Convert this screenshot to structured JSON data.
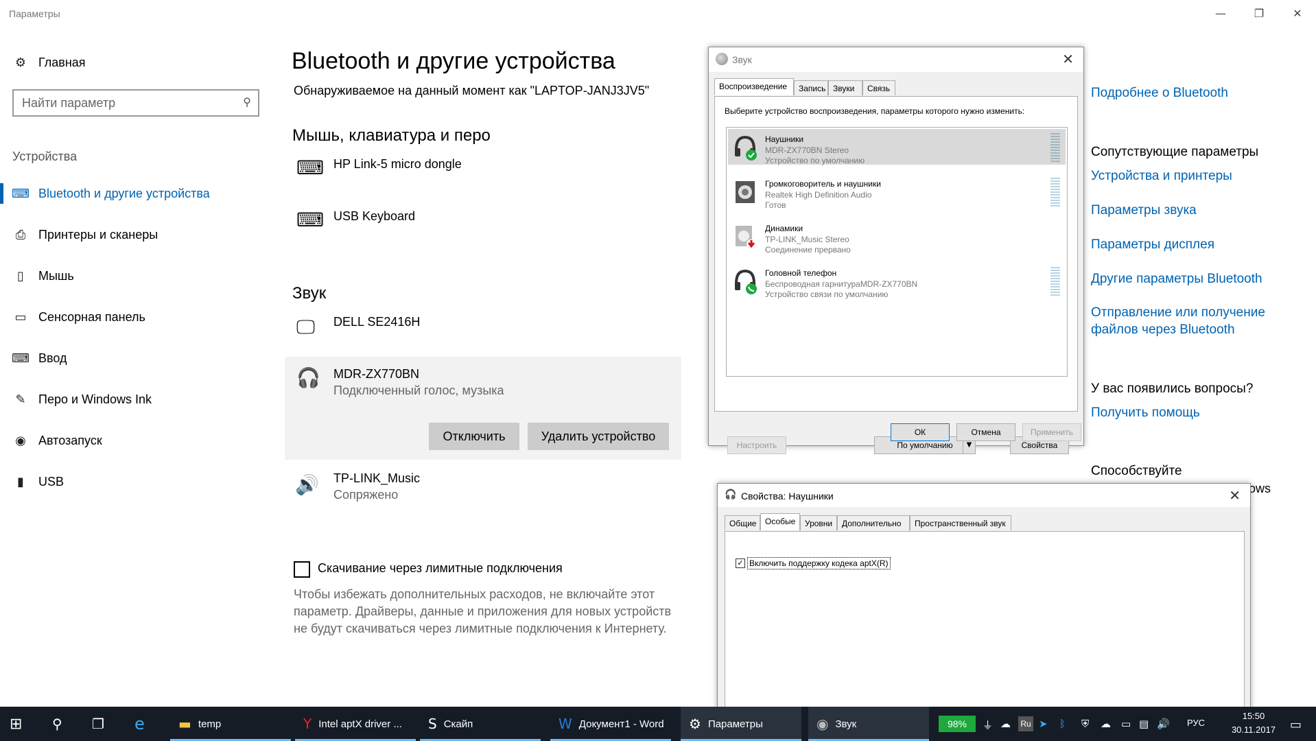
{
  "window": {
    "title": "Параметры",
    "minimize": "—",
    "maximize": "❐",
    "close": "✕"
  },
  "sidebar": {
    "home": "Главная",
    "search_placeholder": "Найти параметр",
    "section": "Устройства",
    "items": [
      {
        "label": "Bluetooth и другие устройства",
        "icon": "bluetooth-devices-icon"
      },
      {
        "label": "Принтеры и сканеры",
        "icon": "printer-icon"
      },
      {
        "label": "Мышь",
        "icon": "mouse-icon"
      },
      {
        "label": "Сенсорная панель",
        "icon": "touchpad-icon"
      },
      {
        "label": "Ввод",
        "icon": "keyboard-icon"
      },
      {
        "label": "Перо и Windows Ink",
        "icon": "pen-icon"
      },
      {
        "label": "Автозапуск",
        "icon": "autoplay-icon"
      },
      {
        "label": "USB",
        "icon": "usb-icon"
      }
    ]
  },
  "main": {
    "title": "Bluetooth и другие устройства",
    "discoverable": "Обнаруживаемое на данный момент как \"LAPTOP-JANJ3JV5\"",
    "section_input": "Мышь, клавиатура и перо",
    "input_devices": [
      "HP Link-5 micro dongle",
      "USB Keyboard"
    ],
    "section_sound": "Звук",
    "sound_devices": [
      {
        "name": "DELL SE2416H",
        "status": ""
      },
      {
        "name": "MDR-ZX770BN",
        "status": "Подключенный голос, музыка"
      },
      {
        "name": "TP-LINK_Music",
        "status": "Сопряжено"
      }
    ],
    "disconnect_btn": "Отключить",
    "remove_btn": "Удалить устройство",
    "metered_label": "Скачивание через лимитные подключения",
    "metered_desc": "Чтобы избежать дополнительных расходов, не включайте этот параметр. Драйверы, данные и приложения для новых устройств не будут скачиваться через лимитные подключения к Интернету."
  },
  "right": {
    "more_bt": "Подробнее о Bluetooth",
    "related": "Сопутствующие параметры",
    "links": [
      "Устройства и принтеры",
      "Параметры звука",
      "Параметры дисплея",
      "Другие параметры Bluetooth"
    ],
    "send_receive_1": "Отправление или получение",
    "send_receive_2": "файлов через Bluetooth",
    "questions": "У вас появились вопросы?",
    "help": "Получить помощь",
    "contribute": "Способствуйте",
    "partial": "ows"
  },
  "sound_dialog": {
    "title": "Звук",
    "tabs": [
      "Воспроизведение",
      "Запись",
      "Звуки",
      "Связь"
    ],
    "prompt": "Выберите устройство воспроизведения, параметры которого нужно изменить:",
    "devices": [
      {
        "name": "Наушники",
        "line1": "MDR-ZX770BN Stereo",
        "line2": "Устройство по умолчанию"
      },
      {
        "name": "Громкоговоритель и наушники",
        "line1": "Realtek High Definition Audio",
        "line2": "Готов"
      },
      {
        "name": "Динамики",
        "line1": "TP-LINK_Music Stereo",
        "line2": "Соединение прервано"
      },
      {
        "name": "Головной телефон",
        "line1": "Беспроводная гарнитураMDR-ZX770BN",
        "line2": "Устройство связи по умолчанию"
      }
    ],
    "configure": "Настроить",
    "set_default": "По умолчанию",
    "properties": "Свойства",
    "ok": "ОК",
    "cancel": "Отмена",
    "apply": "Применить"
  },
  "props_dialog": {
    "title": "Свойства: Наушники",
    "tabs": [
      "Общие",
      "Особые",
      "Уровни",
      "Дополнительно",
      "Пространственный звук"
    ],
    "aptx_label": "Включить поддержку кодека aptX(R)",
    "aptx_checked": true
  },
  "taskbar": {
    "items": [
      "temp",
      "Intel aptX driver ...",
      "Скайп",
      "Документ1 - Word",
      "Параметры",
      "Звук"
    ],
    "battery": "98%",
    "lang_badge": "Ru",
    "lang": "РУС",
    "time": "15:50",
    "date": "30.11.2017"
  },
  "colors": {
    "accent": "#0063b1",
    "taskbar": "#151c26",
    "battery": "#1fa83d"
  }
}
